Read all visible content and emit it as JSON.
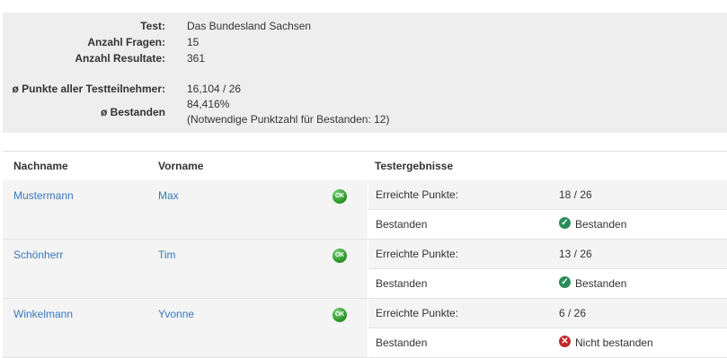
{
  "summary": {
    "test_label": "Test:",
    "test_value": "Das Bundesland Sachsen",
    "questions_label": "Anzahl Fragen:",
    "questions_value": "15",
    "results_label": "Anzahl Resultate:",
    "results_value": "361",
    "avg_points_label": "ø Punkte aller Testteilnehmer:",
    "avg_points_value": "16,104 / 26",
    "passed_label": "ø Bestanden",
    "passed_value": "84,416%",
    "passed_note": "(Notwendige Punktzahl für Bestanden: 12)"
  },
  "table": {
    "col_lastname": "Nachname",
    "col_firstname": "Vorname",
    "col_results": "Testergebnisse",
    "points_label": "Erreichte Punkte:",
    "passed_label": "Bestanden",
    "ok_icon_text": "OK",
    "rows": [
      {
        "lastname": "Mustermann",
        "firstname": "Max",
        "points": "18 / 26",
        "status": "Bestanden",
        "status_icon": "check-icon",
        "status_color": "#2a8c5a"
      },
      {
        "lastname": "Schönherr",
        "firstname": "Tim",
        "points": "13 / 26",
        "status": "Bestanden",
        "status_icon": "check-icon",
        "status_color": "#2a8c5a"
      },
      {
        "lastname": "Winkelmann",
        "firstname": "Yvonne",
        "points": "6 / 26",
        "status": "Nicht bestanden",
        "status_icon": "cross-icon",
        "status_color": "#c0282d"
      }
    ]
  }
}
